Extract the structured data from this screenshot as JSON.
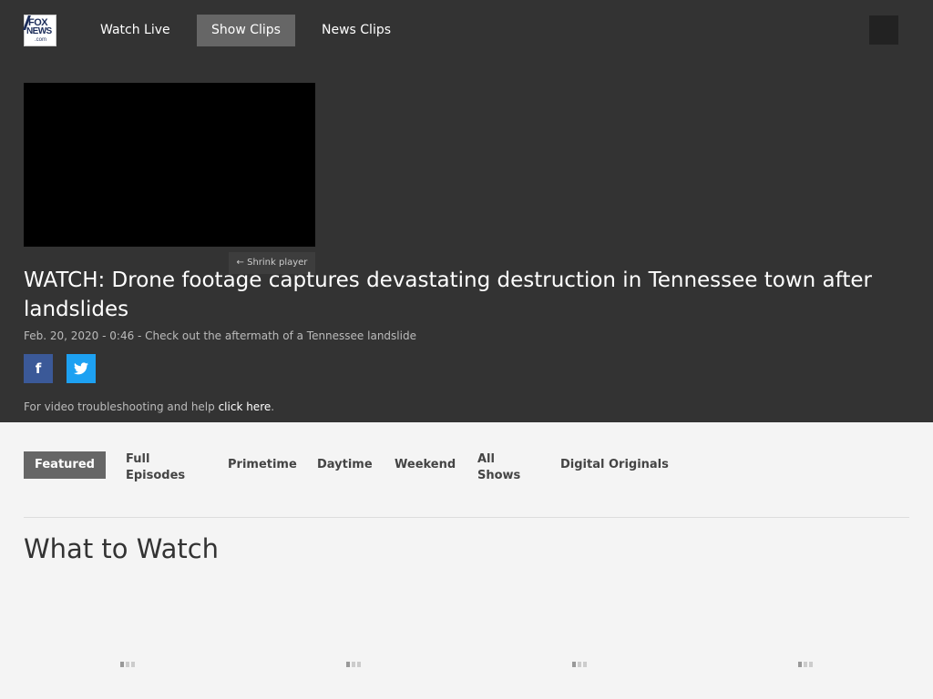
{
  "brand": {
    "logo_line1": "FOX",
    "logo_line2": "NEWS",
    "logo_line3": ".com"
  },
  "nav": {
    "items": [
      {
        "label": "Watch Live"
      },
      {
        "label": "Show Clips",
        "active": true
      },
      {
        "label": "News Clips"
      }
    ]
  },
  "player": {
    "shrink_label": "← Shrink player"
  },
  "video": {
    "title": "WATCH: Drone footage captures devastating destruction in Tennessee town after landslides",
    "meta": "Feb. 20, 2020 - 0:46 - Check out the aftermath of a Tennessee landslide"
  },
  "share": {
    "facebook_glyph": "f",
    "twitter_glyph": "t"
  },
  "help": {
    "text": "For video troubleshooting and help ",
    "link": "click here",
    "suffix": "."
  },
  "tabs": [
    {
      "label": "Featured",
      "active": true
    },
    {
      "label": "Full Episodes"
    },
    {
      "label": "Primetime"
    },
    {
      "label": "Daytime"
    },
    {
      "label": "Weekend"
    },
    {
      "label": "All Shows"
    },
    {
      "label": "Digital Originals"
    }
  ],
  "section": {
    "heading": "What to Watch"
  },
  "colors": {
    "header_bg": "#333333",
    "page_bg": "#f4f4f4",
    "facebook": "#3b5998",
    "twitter": "#1da1f2",
    "active_tab": "#666666"
  }
}
